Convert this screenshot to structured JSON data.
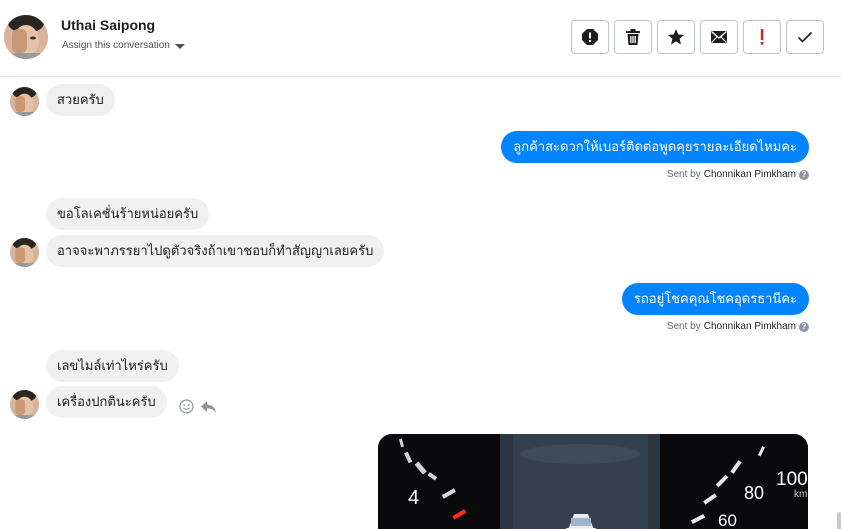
{
  "header": {
    "name": "Uthai Saipong",
    "assign_label": "Assign this conversation",
    "toolbar": [
      {
        "name": "spam-button",
        "icon": "alert-octagon-icon"
      },
      {
        "name": "delete-button",
        "icon": "trash-icon"
      },
      {
        "name": "star-button",
        "icon": "star-icon"
      },
      {
        "name": "mark-unread-button",
        "icon": "envelope-icon"
      },
      {
        "name": "flag-button",
        "icon": "exclamation-icon"
      },
      {
        "name": "done-button",
        "icon": "checkmark-icon"
      }
    ]
  },
  "messages": [
    {
      "direction": "in",
      "text": "สวยครับ"
    },
    {
      "direction": "out",
      "text": "ลูกค้าสะดวกให้เบอร์ติดต่อพูดคุยรายละเอียดไหมคะ",
      "sent_by_prefix": "Sent by",
      "sent_by": "Chonnikan Pimkham"
    },
    {
      "direction": "in",
      "text": "ขอโลเคชั่นร้ายหน่อยครับ"
    },
    {
      "direction": "in",
      "text": "อาจจะพาภรรยาไปดูตัวจริงถ้าเขาชอบก็ทำสัญญาเลยครับ"
    },
    {
      "direction": "out",
      "text": "รถอยู่โชคคุณโชคอุดรธานีคะ",
      "sent_by_prefix": "Sent by",
      "sent_by": "Chonnikan Pimkham"
    },
    {
      "direction": "in",
      "text": "เลขไมล์เท่าไหร่ครับ"
    },
    {
      "direction": "in",
      "text": "เครื่องปกตินะครับ"
    }
  ],
  "photo": {
    "gauge_left_label": "4",
    "gauge_right_labels": [
      "100",
      "80",
      "60"
    ],
    "unit": "km"
  },
  "colors": {
    "outgoing": "#0084ff",
    "incoming": "#f0f0f0"
  }
}
